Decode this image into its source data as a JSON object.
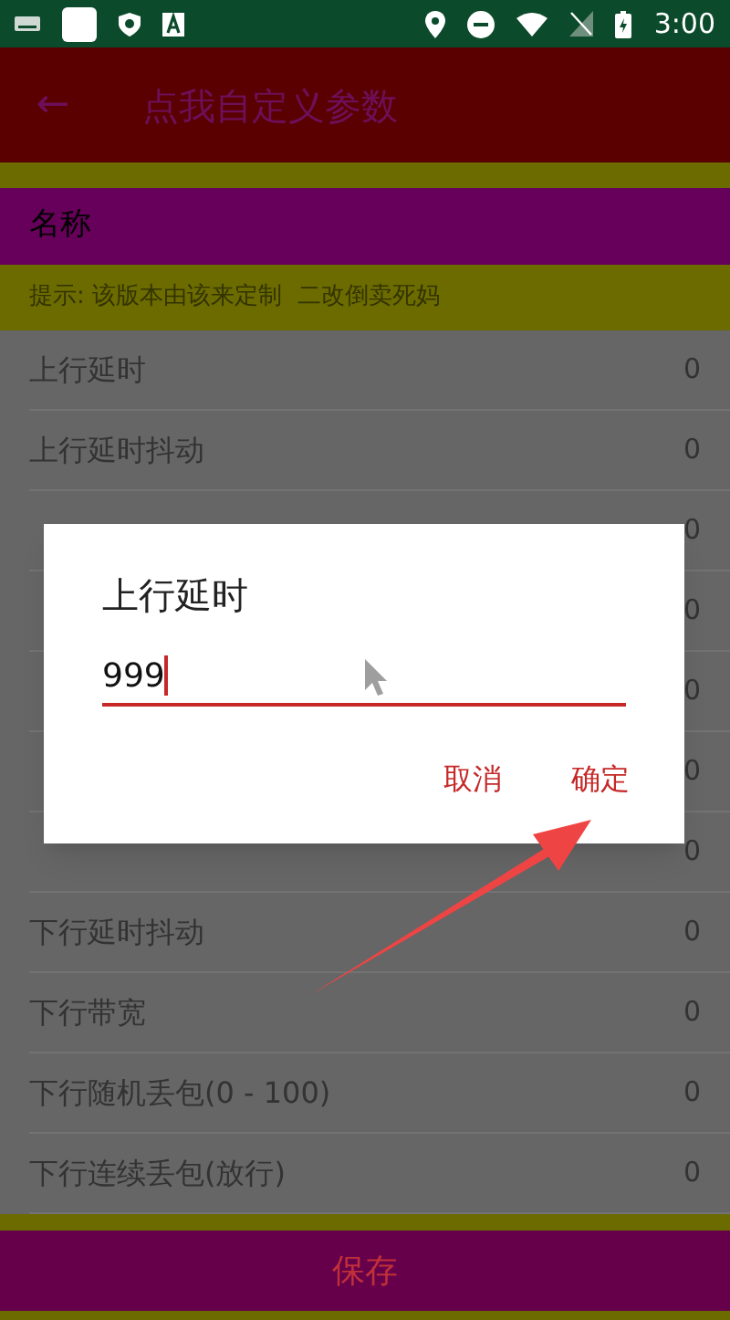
{
  "status_bar": {
    "time": "3:00"
  },
  "toolbar": {
    "back": "←",
    "title": "点我自定义参数"
  },
  "name_field": {
    "label": "名称"
  },
  "hint": "提示: 该版本由该来定制  二改倒卖死妈",
  "rows": [
    {
      "label": "上行延时",
      "value": "0"
    },
    {
      "label": "上行延时抖动",
      "value": "0"
    },
    {
      "value": "0"
    },
    {
      "value": "0"
    },
    {
      "value": "0"
    },
    {
      "value": "0"
    },
    {
      "value": "0"
    },
    {
      "label": "下行延时抖动",
      "value": "0"
    },
    {
      "label": "下行带宽",
      "value": "0"
    },
    {
      "label": "下行随机丢包(0 - 100)",
      "value": "0"
    },
    {
      "label": "下行连续丢包(放行)",
      "value": "0"
    }
  ],
  "save_button": "保存",
  "dialog": {
    "title": "上行延时",
    "value": "999",
    "buttons": [
      "取消",
      "确定"
    ]
  }
}
